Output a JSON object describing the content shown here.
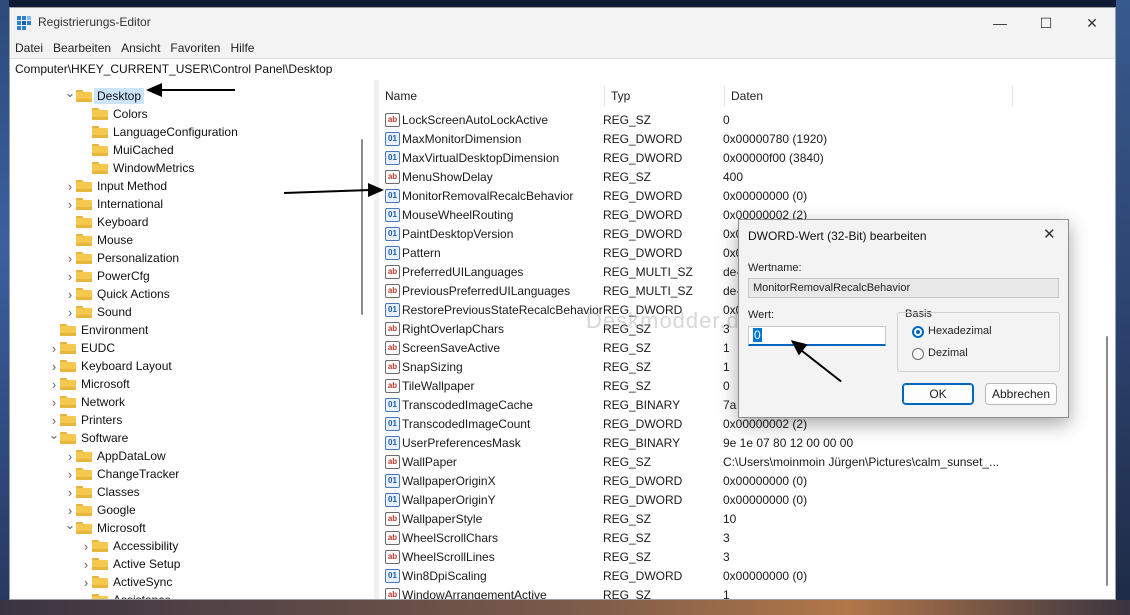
{
  "window": {
    "title": "Registrierungs-Editor",
    "minimize_glyph": "—",
    "maximize_glyph": "☐",
    "close_glyph": "✕"
  },
  "menu": [
    "Datei",
    "Bearbeiten",
    "Ansicht",
    "Favoriten",
    "Hilfe"
  ],
  "address": "Computer\\HKEY_CURRENT_USER\\Control Panel\\Desktop",
  "tree": [
    {
      "label": "Desktop",
      "expanded": true,
      "selected": true
    },
    {
      "label": "Colors"
    },
    {
      "label": "LanguageConfiguration"
    },
    {
      "label": "MuiCached"
    },
    {
      "label": "WindowMetrics"
    },
    {
      "label": "Input Method",
      "expandable": true
    },
    {
      "label": "International",
      "expandable": true
    },
    {
      "label": "Keyboard"
    },
    {
      "label": "Mouse"
    },
    {
      "label": "Personalization",
      "expandable": true
    },
    {
      "label": "PowerCfg",
      "expandable": true
    },
    {
      "label": "Quick Actions",
      "expandable": true
    },
    {
      "label": "Sound",
      "expandable": true
    },
    {
      "label": "Environment"
    },
    {
      "label": "EUDC",
      "expandable": true
    },
    {
      "label": "Keyboard Layout",
      "expandable": true
    },
    {
      "label": "Microsoft",
      "expandable": true
    },
    {
      "label": "Network",
      "expandable": true
    },
    {
      "label": "Printers",
      "expandable": true
    },
    {
      "label": "Software",
      "expanded": true
    },
    {
      "label": "AppDataLow",
      "expandable": true
    },
    {
      "label": "ChangeTracker",
      "expandable": true
    },
    {
      "label": "Classes",
      "expandable": true
    },
    {
      "label": "Google",
      "expandable": true
    },
    {
      "label": "Microsoft",
      "expanded": true
    },
    {
      "label": "Accessibility",
      "expandable": true
    },
    {
      "label": "Active Setup",
      "expandable": true
    },
    {
      "label": "ActiveSync",
      "expandable": true
    },
    {
      "label": "Assistance",
      "expandable": true
    }
  ],
  "columns": {
    "name": "Name",
    "type": "Typ",
    "data": "Daten"
  },
  "values": [
    {
      "name": "LockScreenAutoLockActive",
      "type": "REG_SZ",
      "data": "0",
      "icon": "sz"
    },
    {
      "name": "MaxMonitorDimension",
      "type": "REG_DWORD",
      "data": "0x00000780 (1920)",
      "icon": "bin"
    },
    {
      "name": "MaxVirtualDesktopDimension",
      "type": "REG_DWORD",
      "data": "0x00000f00 (3840)",
      "icon": "bin"
    },
    {
      "name": "MenuShowDelay",
      "type": "REG_SZ",
      "data": "400",
      "icon": "sz"
    },
    {
      "name": "MonitorRemovalRecalcBehavior",
      "type": "REG_DWORD",
      "data": "0x00000000 (0)",
      "icon": "bin"
    },
    {
      "name": "MouseWheelRouting",
      "type": "REG_DWORD",
      "data": "0x00000002 (2)",
      "icon": "bin"
    },
    {
      "name": "PaintDesktopVersion",
      "type": "REG_DWORD",
      "data": "0x0",
      "icon": "bin"
    },
    {
      "name": "Pattern",
      "type": "REG_DWORD",
      "data": "0x0",
      "icon": "bin"
    },
    {
      "name": "PreferredUILanguages",
      "type": "REG_MULTI_SZ",
      "data": "de-",
      "icon": "sz"
    },
    {
      "name": "PreviousPreferredUILanguages",
      "type": "REG_MULTI_SZ",
      "data": "de-",
      "icon": "sz"
    },
    {
      "name": "RestorePreviousStateRecalcBehavior",
      "type": "REG_DWORD",
      "data": "0x0",
      "icon": "bin"
    },
    {
      "name": "RightOverlapChars",
      "type": "REG_SZ",
      "data": "3",
      "icon": "sz"
    },
    {
      "name": "ScreenSaveActive",
      "type": "REG_SZ",
      "data": "1",
      "icon": "sz"
    },
    {
      "name": "SnapSizing",
      "type": "REG_SZ",
      "data": "1",
      "icon": "sz"
    },
    {
      "name": "TileWallpaper",
      "type": "REG_SZ",
      "data": "0",
      "icon": "sz"
    },
    {
      "name": "TranscodedImageCache",
      "type": "REG_BINARY",
      "data": "7a",
      "icon": "bin"
    },
    {
      "name": "TranscodedImageCount",
      "type": "REG_DWORD",
      "data": "0x00000002 (2)",
      "icon": "bin"
    },
    {
      "name": "UserPreferencesMask",
      "type": "REG_BINARY",
      "data": "9e 1e 07 80 12 00 00 00",
      "icon": "bin"
    },
    {
      "name": "WallPaper",
      "type": "REG_SZ",
      "data": "C:\\Users\\moinmoin Jürgen\\Pictures\\calm_sunset_...",
      "icon": "sz"
    },
    {
      "name": "WallpaperOriginX",
      "type": "REG_DWORD",
      "data": "0x00000000 (0)",
      "icon": "bin"
    },
    {
      "name": "WallpaperOriginY",
      "type": "REG_DWORD",
      "data": "0x00000000 (0)",
      "icon": "bin"
    },
    {
      "name": "WallpaperStyle",
      "type": "REG_SZ",
      "data": "10",
      "icon": "sz"
    },
    {
      "name": "WheelScrollChars",
      "type": "REG_SZ",
      "data": "3",
      "icon": "sz"
    },
    {
      "name": "WheelScrollLines",
      "type": "REG_SZ",
      "data": "3",
      "icon": "sz"
    },
    {
      "name": "Win8DpiScaling",
      "type": "REG_DWORD",
      "data": "0x00000000 (0)",
      "icon": "bin"
    },
    {
      "name": "WindowArrangementActive",
      "type": "REG_SZ",
      "data": "1",
      "icon": "sz"
    }
  ],
  "dialog": {
    "title": "DWORD-Wert (32-Bit) bearbeiten",
    "close_glyph": "✕",
    "value_name_label": "Wertname:",
    "value_name": "MonitorRemovalRecalcBehavior",
    "value_label": "Wert:",
    "value": "0",
    "basis_label": "Basis",
    "hex_label": "Hexadezimal",
    "dec_label": "Dezimal",
    "ok_label": "OK",
    "cancel_label": "Abbrechen"
  },
  "watermark": "Deskmodder.de",
  "colors": {
    "accent": "#0067c0",
    "selection": "#cce4f7",
    "folder": "#f5c94f"
  }
}
